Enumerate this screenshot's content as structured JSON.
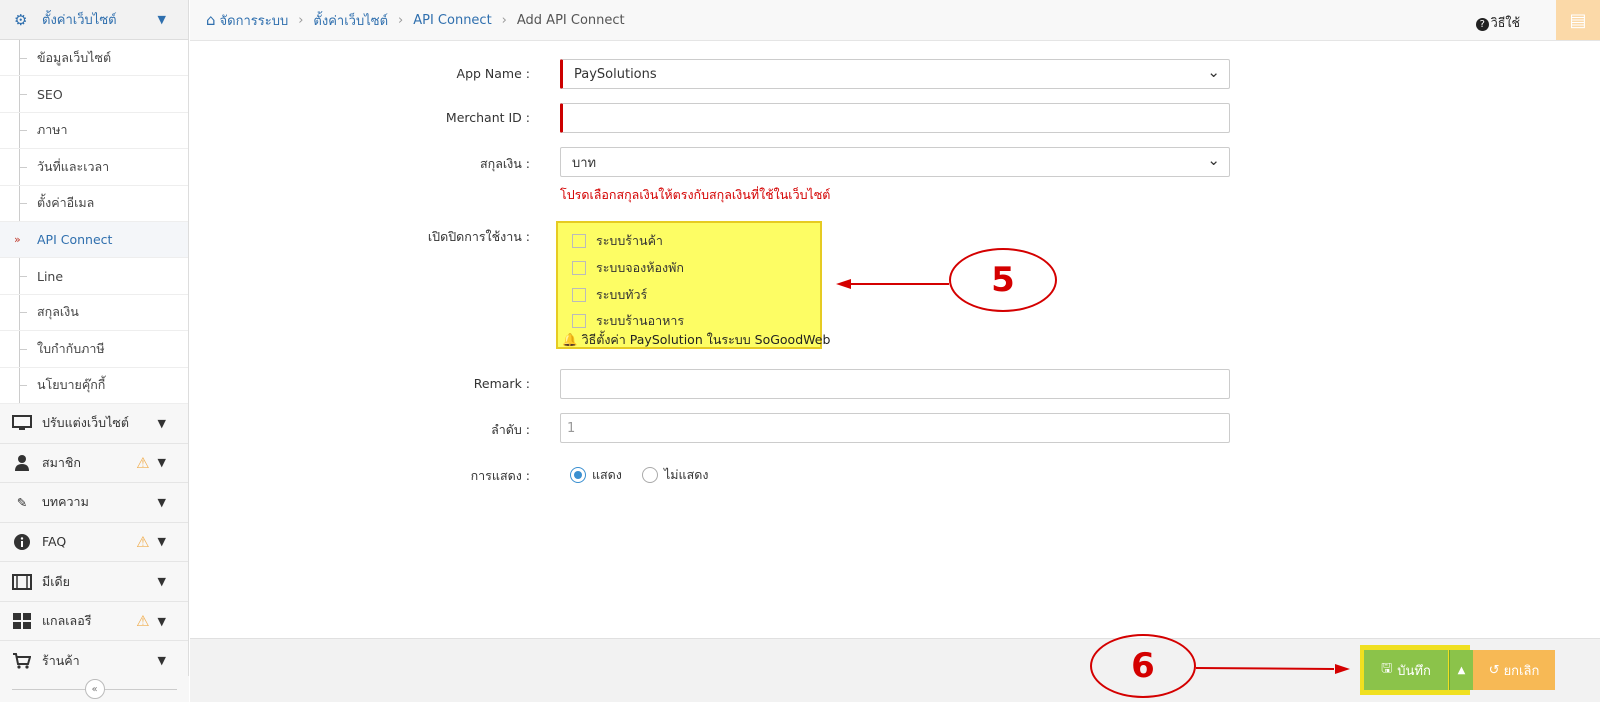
{
  "sidebar": {
    "header": {
      "label": "ตั้งค่าเว็บไซต์",
      "icon": "gear-icon"
    },
    "sub_items": [
      {
        "label": "ข้อมูลเว็บไซต์"
      },
      {
        "label": "SEO"
      },
      {
        "label": "ภาษา"
      },
      {
        "label": "วันที่และเวลา"
      },
      {
        "label": "ตั้งค่าอีเมล"
      },
      {
        "label": "API Connect",
        "active": true
      },
      {
        "label": "Line"
      },
      {
        "label": "สกุลเงิน"
      },
      {
        "label": "ใบกำกับภาษี"
      },
      {
        "label": "นโยบายคุ๊กกี้"
      }
    ],
    "menu": [
      {
        "label": "ปรับแต่งเว็บไซต์",
        "icon": "monitor-icon",
        "warning": false
      },
      {
        "label": "สมาชิก",
        "icon": "user-icon",
        "warning": true
      },
      {
        "label": "บทความ",
        "icon": "edit-icon",
        "warning": false
      },
      {
        "label": "FAQ",
        "icon": "info-icon",
        "warning": true
      },
      {
        "label": "มีเดีย",
        "icon": "film-icon",
        "warning": false
      },
      {
        "label": "แกลเลอรี",
        "icon": "grid-icon",
        "warning": true
      },
      {
        "label": "ร้านค้า",
        "icon": "cart-icon",
        "warning": false
      }
    ]
  },
  "breadcrumb": {
    "items": [
      "จัดการระบบ",
      "ตั้งค่าเว็บไซต์",
      "API Connect",
      "Add API Connect"
    ]
  },
  "help_label": "วิธีใช้",
  "form": {
    "app_name": {
      "label": "App Name :",
      "value": "PaySolutions"
    },
    "merchant_id": {
      "label": "Merchant ID :",
      "value": ""
    },
    "currency": {
      "label": "สกุลเงิน :",
      "value": "บาท",
      "hint": "โปรดเลือกสกุลเงินให้ตรงกับสกุลเงินที่ใช้ในเว็บไซต์"
    },
    "enable": {
      "label": "เปิดปิดการใช้งาน :",
      "options": [
        "ระบบร้านค้า",
        "ระบบจองห้องพัก",
        "ระบบทัวร์",
        "ระบบร้านอาหาร"
      ],
      "note": "วิธีตั้งค่า PaySolution ในระบบ SoGoodWeb"
    },
    "remark": {
      "label": "Remark :",
      "value": ""
    },
    "order": {
      "label": "ลำดับ :",
      "value": "1"
    },
    "display": {
      "label": "การแสดง :",
      "options": [
        "แสดง",
        "ไม่แสดง"
      ],
      "selected": "แสดง"
    }
  },
  "footer": {
    "save_label": "บันทึก",
    "cancel_label": "ยกเลิก"
  },
  "annotations": {
    "step5": "5",
    "step6": "6"
  },
  "colors": {
    "link": "#2f6fae",
    "required": "#cc0000",
    "highlight": "#fdfd64",
    "save": "#8bc34a",
    "cancel": "#f7b955",
    "annotation": "#d40000"
  }
}
